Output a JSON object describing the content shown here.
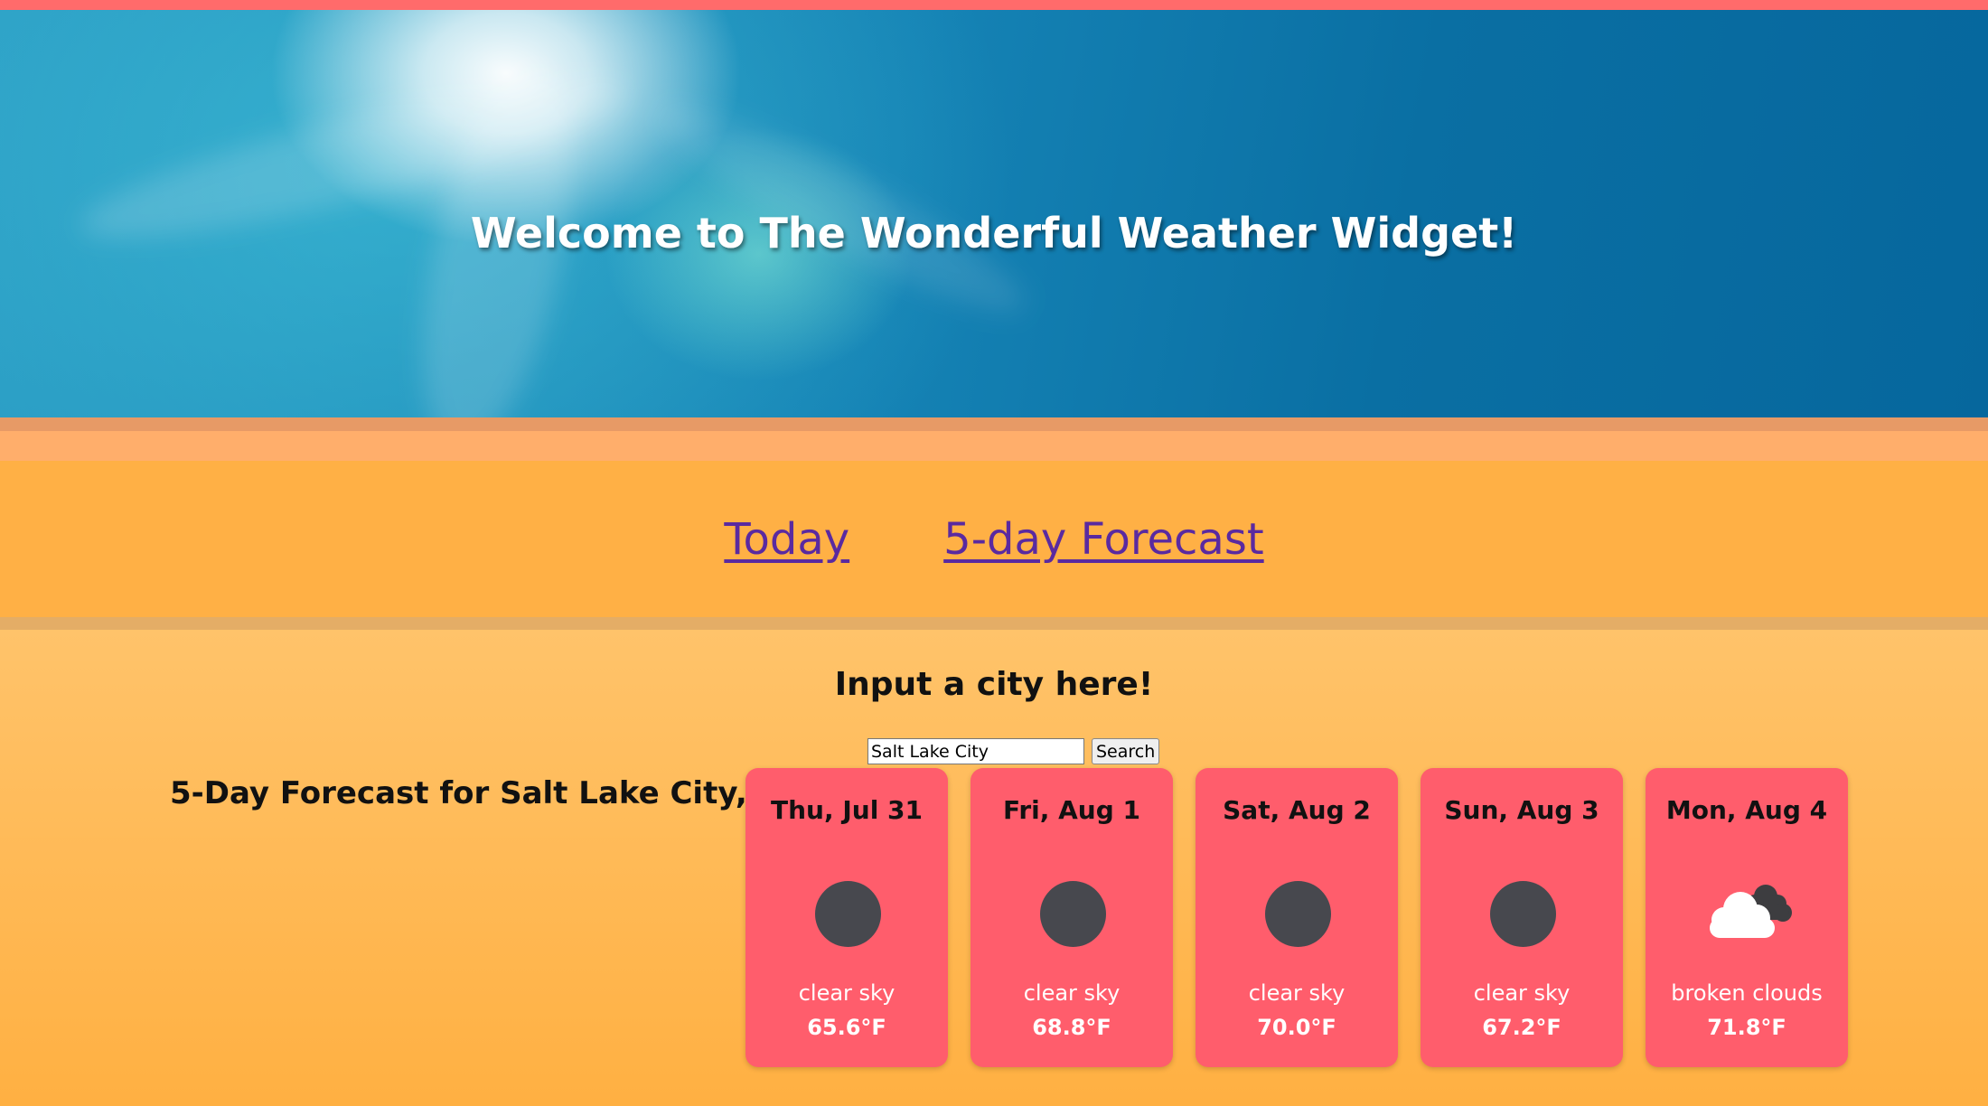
{
  "header": {
    "title": "Welcome to The Wonderful Weather Widget!"
  },
  "nav": {
    "today": "Today",
    "forecast": "5-day Forecast"
  },
  "search": {
    "prompt": "Input a city here!",
    "value": "Salt Lake City",
    "button": "Search"
  },
  "forecast": {
    "title": "5-Day Forecast for Salt Lake City, US",
    "days": [
      {
        "date": "Thu, Jul 31",
        "icon": "clear-night-icon",
        "description": "clear sky",
        "temp": "65.6°F"
      },
      {
        "date": "Fri, Aug 1",
        "icon": "clear-night-icon",
        "description": "clear sky",
        "temp": "68.8°F"
      },
      {
        "date": "Sat, Aug 2",
        "icon": "clear-night-icon",
        "description": "clear sky",
        "temp": "70.0°F"
      },
      {
        "date": "Sun, Aug 3",
        "icon": "clear-night-icon",
        "description": "clear sky",
        "temp": "67.2°F"
      },
      {
        "date": "Mon, Aug 4",
        "icon": "broken-clouds-icon",
        "description": "broken clouds",
        "temp": "71.8°F"
      }
    ]
  },
  "colors": {
    "accent": "#ff6b6b",
    "nav_background": "#ffb045",
    "card": "#ff5d6c",
    "link": "#5a2aa0"
  }
}
